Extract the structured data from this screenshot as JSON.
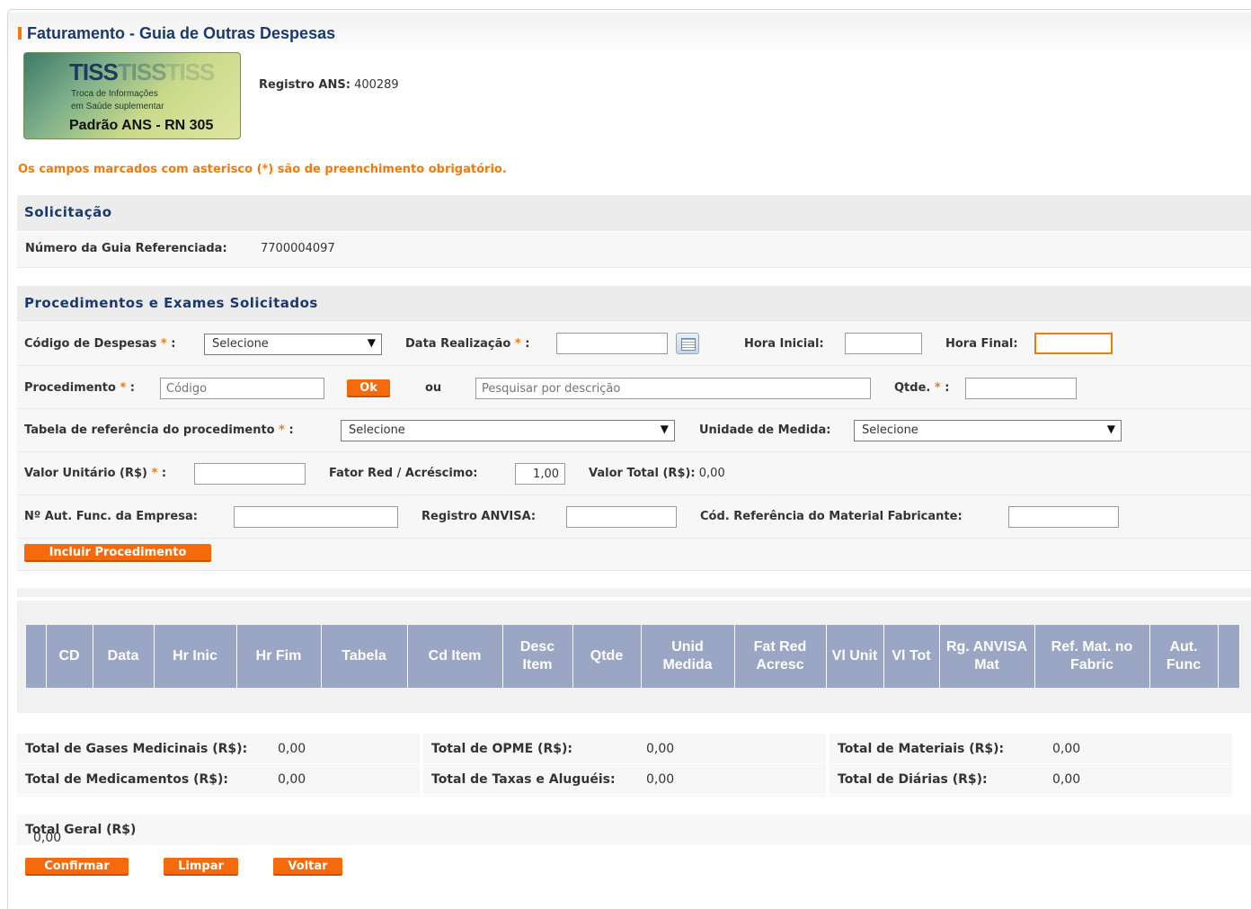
{
  "page": {
    "title": "Faturamento - Guia de Outras Despesas"
  },
  "logo": {
    "brand": "TISS",
    "line1": "Troca de Informações",
    "line2": "em Saúde suplementar",
    "standard": "Padrão ANS - RN 305"
  },
  "registro_ans": {
    "label": "Registro ANS:",
    "value": "400289"
  },
  "mandatory_note": "Os campos marcados com asterisco (*) são de preenchimento obrigatório.",
  "solicitacao": {
    "heading": "Solicitação",
    "guia_label": "Número da Guia Referenciada:",
    "guia_value": "7700004097"
  },
  "procedimentos": {
    "heading": "Procedimentos e Exames Solicitados",
    "codigo_despesas": {
      "label": "Código de Despesas",
      "value": "Selecione"
    },
    "data_realizacao": {
      "label": "Data Realização",
      "value": ""
    },
    "hora_inicial": {
      "label": "Hora Inicial:",
      "value": ""
    },
    "hora_final": {
      "label": "Hora Final:",
      "value": ""
    },
    "procedimento": {
      "label": "Procedimento",
      "placeholder": "Código"
    },
    "ok_button": "Ok",
    "ou": "ou",
    "pesquisa": {
      "placeholder": "Pesquisar por descrição"
    },
    "qtde": {
      "label": "Qtde.",
      "value": ""
    },
    "tabela_ref": {
      "label": "Tabela de referência do procedimento",
      "value": "Selecione"
    },
    "unidade_medida": {
      "label": "Unidade de Medida:",
      "value": "Selecione"
    },
    "valor_unitario": {
      "label": "Valor Unitário (R$)",
      "value": ""
    },
    "fator": {
      "label": "Fator Red / Acréscimo:",
      "value": "1,00"
    },
    "valor_total": {
      "label": "Valor Total (R$):",
      "value": "0,00"
    },
    "aut_func": {
      "label": "Nº Aut. Func. da Empresa:",
      "value": ""
    },
    "anvisa": {
      "label": "Registro ANVISA:",
      "value": ""
    },
    "ref_material": {
      "label": "Cód. Referência do Material Fabricante:",
      "value": ""
    },
    "incluir_button": "Incluir Procedimento",
    "asterisk": "*",
    "colon": ":"
  },
  "table": {
    "columns": [
      "",
      "CD",
      "Data",
      "Hr Inic",
      "Hr Fim",
      "Tabela",
      "Cd Item",
      "Desc Item",
      "Qtde",
      "Unid Medida",
      "Fat Red Acresc",
      "Vl Unit",
      "Vl Tot",
      "Rg. ANVISA Mat",
      "Ref. Mat. no Fabric",
      "Aut. Func",
      ""
    ]
  },
  "totals": {
    "gases": {
      "label": "Total de Gases Medicinais (R$):",
      "value": "0,00"
    },
    "medicamentos": {
      "label": "Total de Medicamentos (R$):",
      "value": "0,00"
    },
    "opme": {
      "label": "Total de OPME (R$):",
      "value": "0,00"
    },
    "taxas": {
      "label": "Total de Taxas e Aluguéis:",
      "value": "0,00"
    },
    "materiais": {
      "label": "Total de Materiais (R$):",
      "value": "0,00"
    },
    "diarias": {
      "label": "Total de Diárias (R$):",
      "value": "0,00"
    },
    "geral": {
      "label": "Total Geral (R$)",
      "value": "0,00"
    }
  },
  "actions": {
    "confirmar": "Confirmar",
    "limpar": "Limpar",
    "voltar": "Voltar"
  },
  "colors": {
    "accent": "#f56a0a",
    "heading": "#1a3a6e",
    "table_header": "#9aa6c4"
  }
}
